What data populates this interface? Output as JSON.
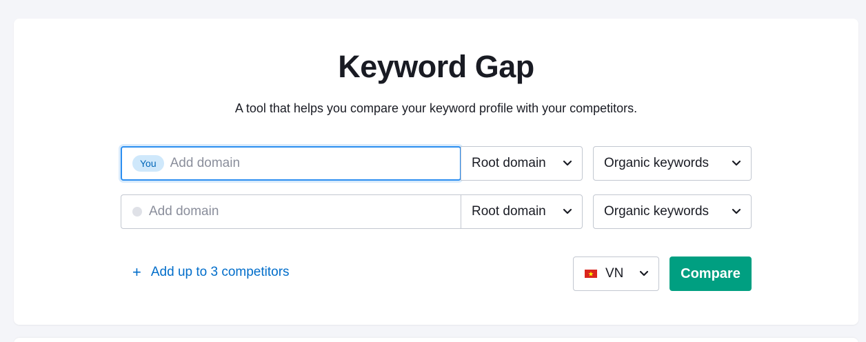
{
  "header": {
    "title": "Keyword Gap",
    "subtitle": "A tool that helps you compare your keyword profile with your competitors."
  },
  "rows": [
    {
      "badge": "You",
      "placeholder": "Add domain",
      "value": "",
      "scope": "Root domain",
      "keyword_type": "Organic keywords"
    },
    {
      "badge": "",
      "placeholder": "Add domain",
      "value": "",
      "scope": "Root domain",
      "keyword_type": "Organic keywords"
    }
  ],
  "actions": {
    "add_competitors_label": "Add up to 3 competitors",
    "country": "VN",
    "compare_label": "Compare"
  },
  "colors": {
    "accent_blue": "#006dca",
    "focus_blue": "#2b8ef0",
    "compare_green": "#009f81",
    "flag_red": "#da251d",
    "flag_yellow": "#ffff00"
  },
  "icons": {
    "chevron": "chevron-down-icon",
    "plus": "plus-icon",
    "flag": "vietnam-flag-icon"
  }
}
